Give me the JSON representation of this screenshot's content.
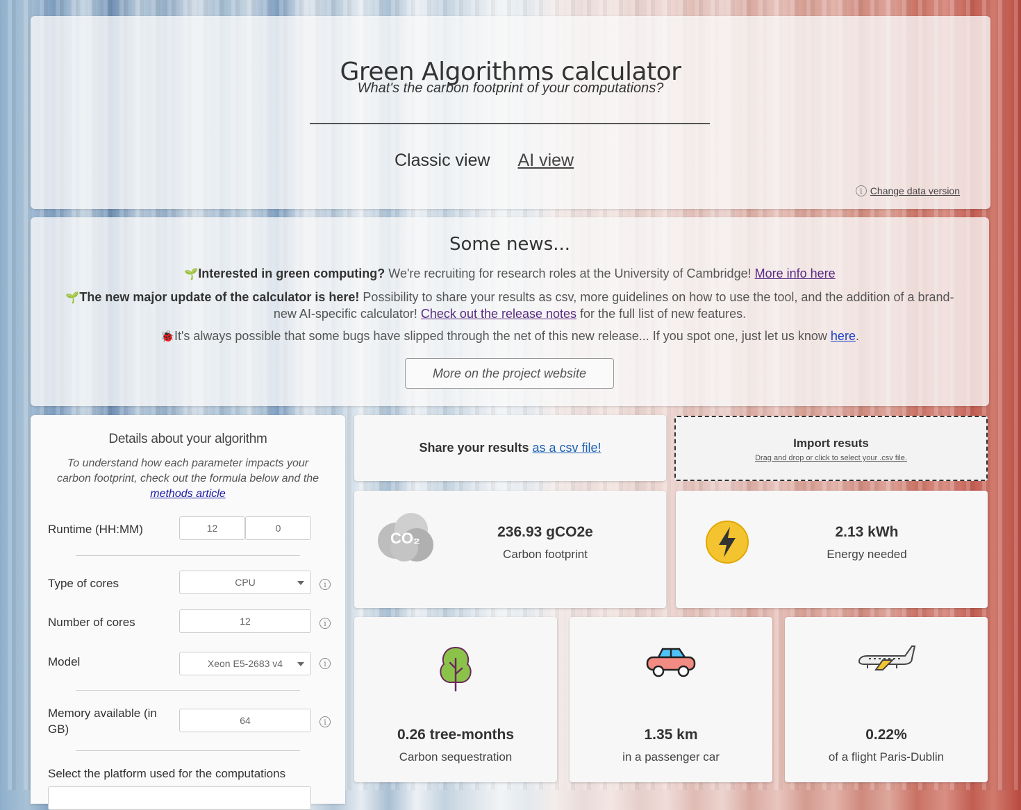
{
  "header": {
    "title": "Green Algorithms calculator",
    "subtitle": "What's the carbon footprint of your computations?",
    "tabs": [
      {
        "label": "Classic view",
        "active": true
      },
      {
        "label": "AI view",
        "active": false
      }
    ],
    "data_version_label": "Change data version",
    "info_glyph": "i"
  },
  "news": {
    "heading": "Some news...",
    "items": [
      {
        "icon": "sprout-icon",
        "bold": "Interested in green computing?",
        "text": " We're recruiting for research roles at the University of Cambridge! ",
        "link": "More info here",
        "after": ""
      },
      {
        "icon": "sprout-icon",
        "bold": "The new major update of the calculator is here!",
        "text": " Possibility to share your results as csv, more guidelines on how to use the tool, and the addition of a brand-new AI-specific calculator! ",
        "link": "Check out the release notes",
        "after": " for the full list of new features."
      },
      {
        "icon": "ladybug-icon",
        "bold": "",
        "text": "It's always possible that some bugs have slipped through the net of this new release... If you spot one, just let us know ",
        "link": "here",
        "after": "."
      }
    ],
    "project_button": "More on the project website"
  },
  "algorithm": {
    "title": "Details about your algorithm",
    "description": "To understand how each parameter impacts your carbon footprint, check out the formula below and the ",
    "description_link": "methods article",
    "runtime_label": "Runtime (HH:MM)",
    "runtime_hours": "12",
    "runtime_minutes": "0",
    "core_type_label": "Type of cores",
    "core_type_value": "CPU",
    "num_cores_label": "Number of cores",
    "num_cores_value": "12",
    "model_label": "Model",
    "model_value": "Xeon E5-2683 v4",
    "memory_label": "Memory available (in GB)",
    "memory_value": "64",
    "platform_label": "Select the platform used for the computations"
  },
  "share": {
    "text": "Share your results",
    "link": "as a csv file!"
  },
  "import": {
    "title": "Import resuts",
    "hint": "Drag and drop or click to select your .csv file."
  },
  "results": {
    "carbon": {
      "value": "236.93 gCO2e",
      "label": "Carbon footprint",
      "icon": "co2-cloud-icon"
    },
    "energy": {
      "value": "2.13 kWh",
      "label": "Energy needed",
      "icon": "lightning-icon"
    },
    "tree": {
      "value": "0.26 tree-months",
      "label": "Carbon sequestration",
      "icon": "tree-icon"
    },
    "car": {
      "value": "1.35 km",
      "label": "in a passenger car",
      "icon": "car-icon"
    },
    "flight": {
      "value": "0.22%",
      "label": "of a flight Paris-Dublin",
      "icon": "airplane-icon"
    },
    "co2_glyph": "CO₂"
  },
  "colors": {
    "lightning_yellow": "#f4c430",
    "tree_green": "#8bc34a",
    "car_pink": "#f28b82",
    "link_blue": "#1a5fb4"
  }
}
